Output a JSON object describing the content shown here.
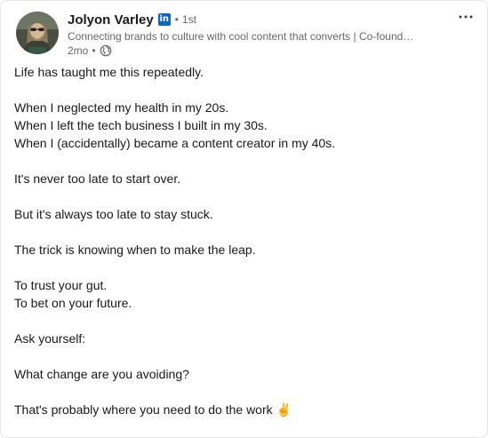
{
  "post": {
    "author": {
      "name": "Jolyon Varley",
      "badge_text": "in",
      "degree": "1st",
      "headline": "Connecting brands to culture with cool content that converts | Co-found…",
      "time": "2mo",
      "separator": "•",
      "visibility_icon": "globe-icon"
    },
    "menu_icon": "more-horizontal-icon",
    "body": {
      "intro": "Life has taught me this repeatedly.",
      "when_lines": [
        "When I neglected my health in my 20s.",
        "When I left the tech business I built in my 30s.",
        "When I (accidentally) became a content creator in my 40s."
      ],
      "never_late": "It's never too late to start over.",
      "too_late": "But it's always too late to stay stuck.",
      "trick": "The trick is knowing when to make the leap.",
      "trust_lines": [
        "To trust your gut.",
        "To bet on your future."
      ],
      "ask": "Ask yourself:",
      "question": "What change are you avoiding?",
      "closing": "That's probably where you need to do the work",
      "closing_emoji": "✌️"
    }
  },
  "colors": {
    "linkedin_blue": "#0a66c2",
    "text_primary": "#191919",
    "text_secondary": "#666666"
  }
}
